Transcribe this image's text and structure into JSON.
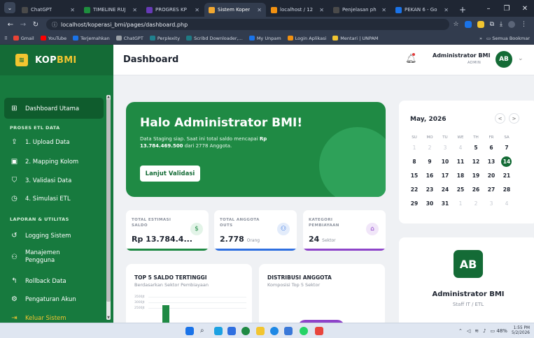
{
  "browser": {
    "tabs": [
      {
        "label": "ChatGPT",
        "color": "#4a4a4a",
        "active": false
      },
      {
        "label": "TIMELINE RUJ",
        "color": "#1e8e3e",
        "active": false
      },
      {
        "label": "PROGRES KP",
        "color": "#673ab7",
        "active": false
      },
      {
        "label": "Sistem Koper",
        "color": "#f2a830",
        "active": true
      },
      {
        "label": "localhost / 12",
        "color": "#f29111",
        "active": false
      },
      {
        "label": "Penjelasan ph",
        "color": "#4a4a4a",
        "active": false
      },
      {
        "label": "PEKAN 6 - Go",
        "color": "#1a73e8",
        "active": false
      }
    ],
    "url": "localhost/koperasi_bmi/pages/dashboard.php",
    "bookmarks": [
      {
        "label": "Gmail",
        "color": "#ea4335"
      },
      {
        "label": "YouTube",
        "color": "#ff0000"
      },
      {
        "label": "Terjemahkan",
        "color": "#1a73e8"
      },
      {
        "label": "ChatGPT",
        "color": "#9aa0a6"
      },
      {
        "label": "Perplexity",
        "color": "#20808d"
      },
      {
        "label": "Scribd Downloader,...",
        "color": "#1e7b85"
      },
      {
        "label": "My Unpam",
        "color": "#1a73e8"
      },
      {
        "label": "Login Aplikasi",
        "color": "#f29111"
      },
      {
        "label": "Mentari | UNPAM",
        "color": "#f2c530"
      }
    ],
    "all_bookmarks": "Semua Bookmar"
  },
  "sidebar": {
    "logo": "KOP",
    "logo_accent": "BMI",
    "active_item": "Dashboard Utama",
    "section_etl": "PROSES ETL DATA",
    "etl_items": [
      "1. Upload Data",
      "2. Mapping Kolom",
      "3. Validasi Data",
      "4. Simulasi ETL"
    ],
    "section_report": "LAPORAN & UTILITAS",
    "report_items": [
      "Logging Sistem",
      "Manajemen",
      "Pengguna",
      "Rollback Data",
      "Pengaturan Akun"
    ],
    "logout": "Keluar Sistem"
  },
  "header": {
    "title": "Dashboard",
    "user_name": "Administrator BMI",
    "user_role": "ADMIN",
    "initials": "AB"
  },
  "hero": {
    "title": "Halo Administrator BMI!",
    "text_prefix": "Data Staging siap. Saat ini total saldo mencapai",
    "amount": "Rp 13.784.469.500",
    "text_suffix": "dari 2778 Anggota.",
    "button": "Lanjut Validasi"
  },
  "stats": [
    {
      "label1": "TOTAL ESTIMASI",
      "label2": "SALDO",
      "value": "Rp 13.784.4...",
      "unit": "",
      "icon": "$",
      "color": "#1f8a44",
      "tint": "#e3f4e8"
    },
    {
      "label1": "TOTAL ANGGOTA",
      "label2": "OUTS",
      "value": "2.778",
      "unit": "Orang",
      "icon": "&",
      "color": "#2f6fe0",
      "tint": "#e3ecfb"
    },
    {
      "label1": "KATEGORI",
      "label2": "PEMBIAYAAN",
      "value": "24",
      "unit": "Sektor",
      "icon": "A",
      "color": "#8e44c9",
      "tint": "#f1e6f9"
    }
  ],
  "charts": {
    "top5_title": "TOP 5 SALDO TERTINGGI",
    "top5_sub": "Berdasarkan Sektor Pembiayaan",
    "y_ticks": [
      "3500Jt",
      "3000Jt",
      "2500Jt"
    ],
    "dist_title": "DISTRIBUSI ANGGOTA",
    "dist_sub": "Komposisi Top 5 Sektor"
  },
  "calendar": {
    "month": "May, 2026",
    "prev": "<",
    "next": ">",
    "weekdays": [
      "SU",
      "MO",
      "TU",
      "WE",
      "TH",
      "FR",
      "SA"
    ],
    "weeks": [
      [
        "1",
        "2",
        "3",
        "4",
        "5",
        "6",
        "7"
      ],
      [
        "8",
        "9",
        "10",
        "11",
        "12",
        "13",
        "14"
      ],
      [
        "15",
        "16",
        "17",
        "18",
        "19",
        "20",
        "21"
      ],
      [
        "22",
        "23",
        "24",
        "25",
        "26",
        "27",
        "28"
      ],
      [
        "29",
        "30",
        "31",
        "1",
        "2",
        "3",
        "4"
      ]
    ],
    "today": "14"
  },
  "profile": {
    "initials": "AB",
    "name": "Administrator BMI",
    "role": "Staff IT / ETL"
  },
  "taskbar": {
    "battery": "48%",
    "time": "1:55 PM",
    "date": "5/2/2026"
  }
}
